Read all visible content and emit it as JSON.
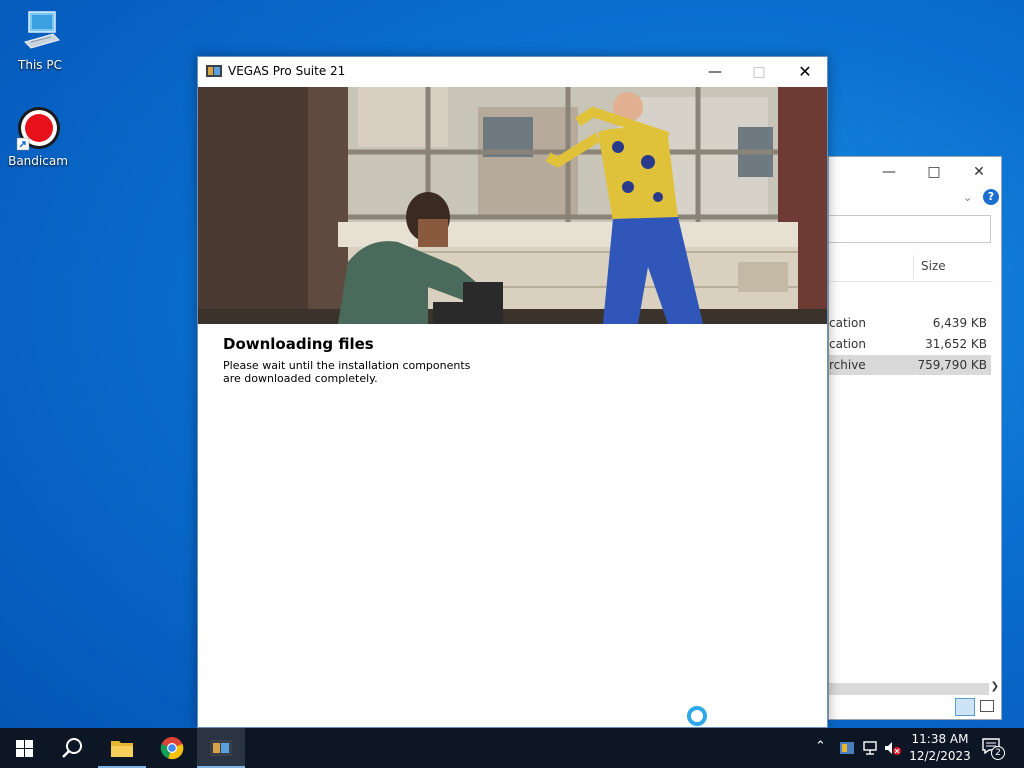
{
  "desktop": {
    "icons": [
      {
        "label": "This PC"
      },
      {
        "label": "Bandicam"
      }
    ]
  },
  "explorer": {
    "column_size": "Size",
    "rows": [
      {
        "type": "cation",
        "size": "6,439 KB"
      },
      {
        "type": "cation",
        "size": "31,652 KB"
      },
      {
        "type": "rchive",
        "size": "759,790 KB"
      }
    ]
  },
  "installer": {
    "title": "VEGAS Pro Suite 21",
    "heading": "Downloading files",
    "description": "Please wait until the installation components are downloaded completely."
  },
  "taskbar": {
    "time": "11:38 AM",
    "date": "12/2/2023",
    "notification_count": "2"
  },
  "colors": {
    "accent": "#2ea8e8",
    "taskbar": "#0c1624",
    "desktop": "#0a6fd0"
  }
}
